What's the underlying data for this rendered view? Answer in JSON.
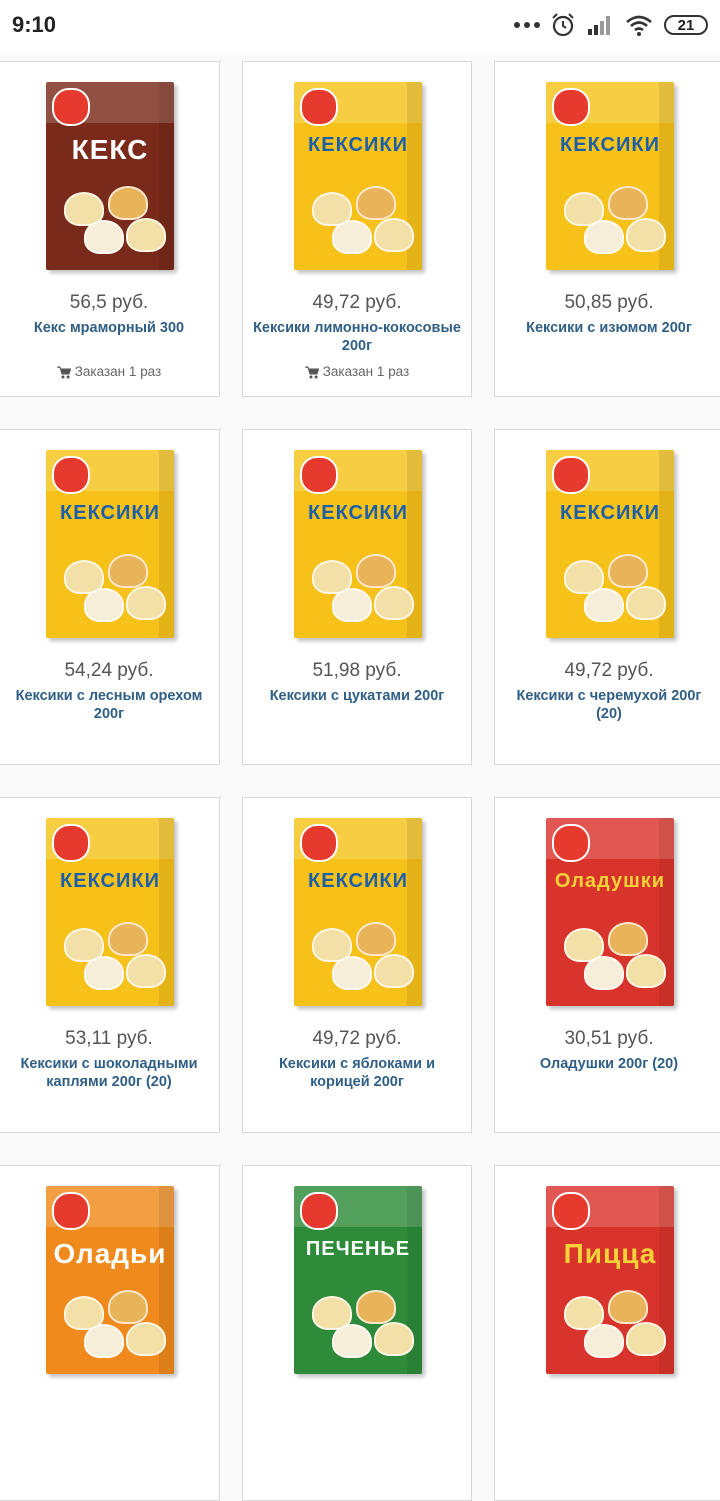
{
  "status_bar": {
    "time": "9:10",
    "battery": "21"
  },
  "colors": {
    "name": "#2f5f86",
    "price": "#555555",
    "border": "#d8d8d8"
  },
  "products": [
    {
      "price": "56,5 руб.",
      "name": "Кекс мраморный 300",
      "ordered": "Заказан 1 раз",
      "box_text": "КЕКС",
      "box_color": "#7a2a1a",
      "box_text_color": "#ffffff"
    },
    {
      "price": "49,72 руб.",
      "name": "Кексики лимонно-кокосовые 200г",
      "ordered": "Заказан 1 раз",
      "box_text": "КЕКСИКИ",
      "box_color": "#f6c21a",
      "box_text_color": "#1c5fa8"
    },
    {
      "price": "50,85 руб.",
      "name": "Кексики с изюмом 200г",
      "ordered": "",
      "box_text": "КЕКСИКИ",
      "box_color": "#f6c21a",
      "box_text_color": "#1c5fa8"
    },
    {
      "price": "54,24 руб.",
      "name": "Кексики с лесным орехом 200г",
      "ordered": "",
      "box_text": "КЕКСИКИ",
      "box_color": "#f6c21a",
      "box_text_color": "#1c5fa8"
    },
    {
      "price": "51,98 руб.",
      "name": "Кексики с цукатами 200г",
      "ordered": "",
      "box_text": "КЕКСИКИ",
      "box_color": "#f6c21a",
      "box_text_color": "#1c5fa8"
    },
    {
      "price": "49,72 руб.",
      "name": "Кексики с черемухой 200г (20)",
      "ordered": "",
      "box_text": "КЕКСИКИ",
      "box_color": "#f6c21a",
      "box_text_color": "#1c5fa8"
    },
    {
      "price": "53,11 руб.",
      "name": "Кексики с шоколадными каплями 200г (20)",
      "ordered": "",
      "box_text": "КЕКСИКИ",
      "box_color": "#f6c21a",
      "box_text_color": "#1c5fa8"
    },
    {
      "price": "49,72 руб.",
      "name": "Кексики с яблоками и корицей 200г",
      "ordered": "",
      "box_text": "КЕКСИКИ",
      "box_color": "#f6c21a",
      "box_text_color": "#1c5fa8"
    },
    {
      "price": "30,51 руб.",
      "name": "Оладушки 200г (20)",
      "ordered": "",
      "box_text": "Оладушки",
      "box_color": "#d9342b",
      "box_text_color": "#f6d23a"
    },
    {
      "price": "",
      "name": "",
      "ordered": "",
      "box_text": "Оладьи",
      "box_color": "#f08a1c",
      "box_text_color": "#ffffff"
    },
    {
      "price": "",
      "name": "",
      "ordered": "",
      "box_text": "ПЕЧЕНЬЕ",
      "box_color": "#2e8b3a",
      "box_text_color": "#ffffff"
    },
    {
      "price": "",
      "name": "",
      "ordered": "",
      "box_text": "Пицца",
      "box_color": "#d9342b",
      "box_text_color": "#f6d23a"
    }
  ]
}
